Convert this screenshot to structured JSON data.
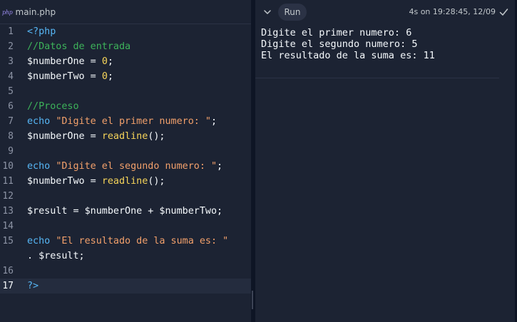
{
  "tab": {
    "icon_text": "php",
    "filename": "main.php"
  },
  "code_lines": [
    {
      "n": "1",
      "tokens": [
        [
          "kw",
          "<?php"
        ]
      ]
    },
    {
      "n": "2",
      "tokens": [
        [
          "cm",
          "//Datos de entrada"
        ]
      ]
    },
    {
      "n": "3",
      "tokens": [
        [
          "",
          "$numberOne = "
        ],
        [
          "nm",
          "0"
        ],
        [
          "",
          ";"
        ]
      ]
    },
    {
      "n": "4",
      "tokens": [
        [
          "",
          "$numberTwo = "
        ],
        [
          "nm",
          "0"
        ],
        [
          "",
          ";"
        ]
      ]
    },
    {
      "n": "5",
      "tokens": []
    },
    {
      "n": "6",
      "tokens": [
        [
          "cm",
          "//Proceso"
        ]
      ]
    },
    {
      "n": "7",
      "tokens": [
        [
          "kw",
          "echo"
        ],
        [
          "",
          " "
        ],
        [
          "st",
          "\"Digite el primer numero: \""
        ],
        [
          "",
          ";"
        ]
      ]
    },
    {
      "n": "8",
      "tokens": [
        [
          "",
          "$numberOne = "
        ],
        [
          "fn",
          "readline"
        ],
        [
          "",
          "();"
        ]
      ]
    },
    {
      "n": "9",
      "tokens": []
    },
    {
      "n": "10",
      "tokens": [
        [
          "kw",
          "echo"
        ],
        [
          "",
          " "
        ],
        [
          "st",
          "\"Digite el segundo numero: \""
        ],
        [
          "",
          ";"
        ]
      ]
    },
    {
      "n": "11",
      "tokens": [
        [
          "",
          "$numberTwo = "
        ],
        [
          "fn",
          "readline"
        ],
        [
          "",
          "();"
        ]
      ]
    },
    {
      "n": "12",
      "tokens": []
    },
    {
      "n": "13",
      "tokens": [
        [
          "",
          "$result = $numberOne + $numberTwo;"
        ]
      ]
    },
    {
      "n": "14",
      "tokens": []
    },
    {
      "n": "15",
      "tokens": [
        [
          "kw",
          "echo"
        ],
        [
          "",
          " "
        ],
        [
          "st",
          "\"El resultado de la suma es: \""
        ]
      ]
    },
    {
      "n": "",
      "tokens": [
        [
          "",
          ". $result;"
        ]
      ]
    },
    {
      "n": "16",
      "tokens": []
    },
    {
      "n": "17",
      "tokens": [
        [
          "kw",
          "?>"
        ]
      ],
      "active": true
    }
  ],
  "console": {
    "run_label": "Run",
    "run_meta": "4s on 19:28:45, 12/09",
    "output": [
      "Digite el primer numero: 6",
      "Digite el segundo numero: 5",
      "El resultado de la suma es: 11"
    ]
  },
  "colors": {
    "editor_bg": "#1c2333",
    "app_bg": "#0e1525",
    "keyword": "#56b6f5",
    "comment": "#3db35a",
    "string": "#f2a06b",
    "number": "#f7d55a"
  },
  "icons": [
    "php-file-icon",
    "chevron-down-icon",
    "check-icon"
  ]
}
